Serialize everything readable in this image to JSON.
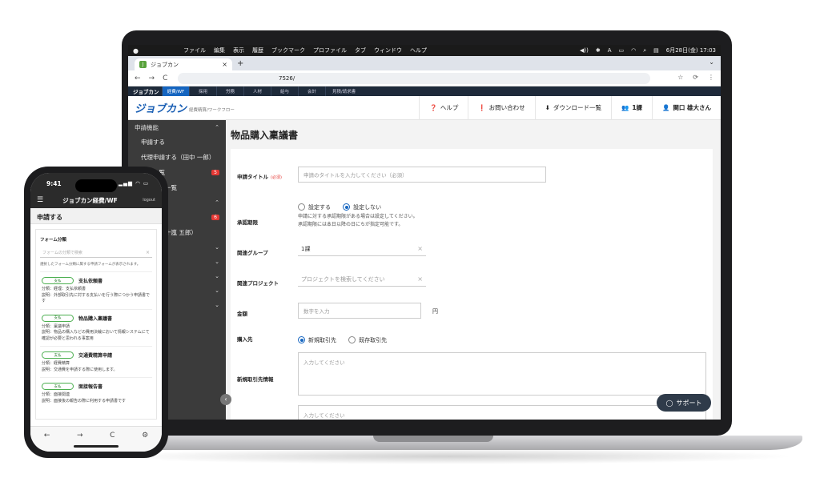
{
  "mac_menubar": {
    "menus": [
      "ファイル",
      "編集",
      "表示",
      "履歴",
      "ブックマーク",
      "プロファイル",
      "タブ",
      "ウィンドウ",
      "ヘルプ"
    ],
    "tray": [
      "◀))",
      "✱",
      "A",
      "▭",
      "◠",
      "⌕",
      "▤"
    ],
    "clock": "6月28日(金) 17:03"
  },
  "browser": {
    "tab_title": "ジョブカン",
    "tab_favicon": "J",
    "new_tab": "+",
    "url": "7526/",
    "icons": {
      "back": "←",
      "forward": "→",
      "reload": "C",
      "star": "☆",
      "extensions": "⟳",
      "menu": "⋮",
      "tab_close": "×",
      "tab_list": "⌄"
    }
  },
  "app_bar": {
    "brand": "ジョブカン",
    "items": [
      "経費/WF",
      "採用",
      "労務",
      "人材",
      "給与",
      "会計",
      "見積/請求書"
    ]
  },
  "header": {
    "logo": "ジョブカン",
    "logo_sub": "経費精算/ワークフロー",
    "help": "ヘルプ",
    "contact": "お問い合わせ",
    "download": "ダウンロード一覧",
    "group": "1課",
    "user": "関口 雄大さん"
  },
  "sidebar": {
    "section1": "申請機能",
    "items": [
      {
        "label": "申請する",
        "badge": ""
      },
      {
        "label": "代理申請する（田中 一郎）",
        "badge": ""
      },
      {
        "label": "申請一覧",
        "badge": "5"
      },
      {
        "label": "ファイル一覧",
        "badge": ""
      }
    ],
    "items2": [
      {
        "label": "",
        "badge": "6"
      },
      {
        "label": "する（五十嵐 五郎）",
        "badge": ""
      },
      {
        "label": "",
        "badge": ""
      },
      {
        "label": "能",
        "badge": ""
      },
      {
        "label": "",
        "badge": ""
      },
      {
        "label": "",
        "badge": ""
      },
      {
        "label": "",
        "badge": ""
      }
    ],
    "collapse": "‹"
  },
  "form": {
    "page_title": "物品購入稟議書",
    "title_label": "申請タイトル",
    "required": "(必須)",
    "title_placeholder": "申請のタイトルを入力してください（必須）",
    "deadline_label": "承認期限",
    "deadline_options": [
      "設定する",
      "設定しない"
    ],
    "deadline_note1": "申請に対する承認期限がある場合は設定してください。",
    "deadline_note2": "承認期限には本日以降の日にちが指定可能です。",
    "group_label": "関連グループ",
    "group_value": "1課",
    "project_label": "関連プロジェクト",
    "project_placeholder": "プロジェクトを検索してください",
    "amount_label": "金額",
    "amount_placeholder": "数字を入力",
    "amount_unit": "円",
    "vendor_label": "購入先",
    "vendor_options": [
      "新規取引先",
      "既存取引先"
    ],
    "newvendor_label": "新規取引先情報",
    "textarea_placeholder": "入力してください",
    "clear": "×",
    "support": "サポート"
  },
  "phone": {
    "time": "9:41",
    "status_icons": "▂▄▆ ◠ ▭",
    "nav_menu": "☰",
    "nav_title": "ジョブカン経費/WF",
    "logout": "logout",
    "page_title": "申請する",
    "form_type_label": "フォーム分類",
    "search_placeholder": "フォームの分類で検索",
    "clear": "×",
    "hint": "選択したフォーム分類に属する申請フォームが表示されます。",
    "items": [
      {
        "tag": "支払",
        "name": "支払依頼書",
        "desc1": "分類：経理：支払依頼書",
        "desc2": "説明：外部取引先に対する支払いを行う際につかう申請書です"
      },
      {
        "tag": "支払",
        "name": "物品購入稟議書",
        "desc1": "分類：稟議申請",
        "desc2": "説明：物品の購入などの費用決裁において情報システムにて確認が必要と思われる事案用"
      },
      {
        "tag": "支払",
        "name": "交通費精算申請",
        "desc1": "分類：経費精算",
        "desc2": "説明：交通費を申請する際に使用します。"
      },
      {
        "tag": "支払",
        "name": "面接報告書",
        "desc1": "分類：面接関連",
        "desc2": "説明：面接後の報告の際に利用する申請書です"
      }
    ],
    "bottom": [
      "←",
      "→",
      "C",
      "⚙"
    ]
  }
}
